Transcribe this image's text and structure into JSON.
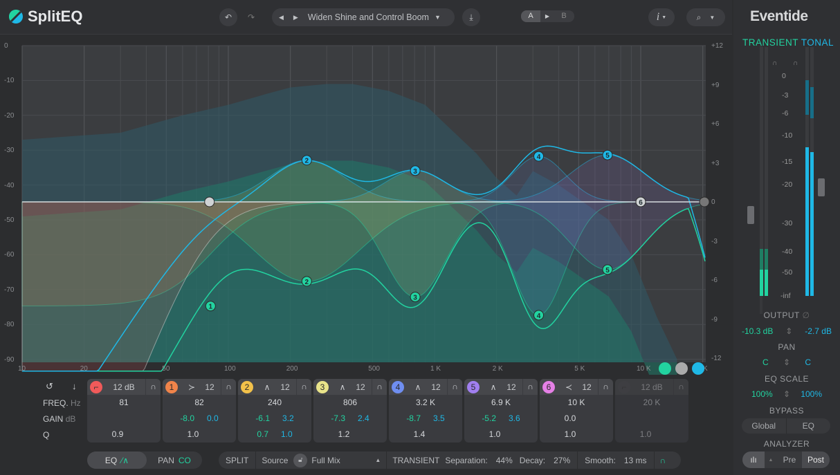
{
  "app": {
    "title": "SplitEQ",
    "preset": "Widen Shine and Control Boom",
    "ab": {
      "a": "A",
      "b": "B"
    },
    "info": "i"
  },
  "colors": {
    "transient": "#22d3a0",
    "tonal": "#1fb8e6",
    "band1": "#f0844a",
    "band2": "#f2c14a",
    "band3": "#e9e48a",
    "band4": "#6f8ef0",
    "band5": "#a17ff0",
    "band6": "#e580e6",
    "lowcut": "#f05a5a"
  },
  "graph": {
    "left_axis": [
      "0",
      "-10",
      "-20",
      "-30",
      "-40",
      "-50",
      "-60",
      "-70",
      "-80",
      "-90"
    ],
    "right_axis": [
      "+12",
      "+9",
      "+6",
      "+3",
      "0",
      "-3",
      "-6",
      "-9",
      "-12"
    ],
    "freq_axis": [
      {
        "f": 10,
        "l": "10"
      },
      {
        "f": 20,
        "l": "20"
      },
      {
        "f": 50,
        "l": "50"
      },
      {
        "f": 100,
        "l": "100"
      },
      {
        "f": 200,
        "l": "200"
      },
      {
        "f": 500,
        "l": "500"
      },
      {
        "f": 1000,
        "l": "1 K"
      },
      {
        "f": 2000,
        "l": "2 K"
      },
      {
        "f": 5000,
        "l": "5 K"
      },
      {
        "f": 10000,
        "l": "10 K"
      },
      {
        "f": 21000,
        "l": "K"
      }
    ]
  },
  "row_labels": {
    "freq": "FREQ.",
    "freq_unit": "Hz",
    "gain": "GAIN",
    "gain_unit": "dB",
    "q": "Q"
  },
  "bands": [
    {
      "id": "lowcut",
      "num": "",
      "type_icon": "lowcut-icon",
      "slope": "12 dB",
      "freq": "81",
      "freq_hz": 81,
      "gain_t": "",
      "gain_s": "",
      "q_t": "0.9",
      "q_s": "",
      "enabled": true
    },
    {
      "id": "1",
      "num": "1",
      "type_icon": "low-shelf-icon",
      "slope": "12",
      "freq": "82",
      "freq_hz": 82,
      "gain_t": "-8.0",
      "gain_s": "0.0",
      "q_t": "1.0",
      "q_s": "",
      "enabled": true
    },
    {
      "id": "2",
      "num": "2",
      "type_icon": "bell-icon",
      "slope": "12",
      "freq": "240",
      "freq_hz": 240,
      "gain_t": "-6.1",
      "gain_s": "3.2",
      "q_t": "0.7",
      "q_s": "1.0",
      "enabled": true
    },
    {
      "id": "3",
      "num": "3",
      "type_icon": "bell-icon",
      "slope": "12",
      "freq": "806",
      "freq_hz": 806,
      "gain_t": "-7.3",
      "gain_s": "2.4",
      "q_t": "1.2",
      "q_s": "",
      "enabled": true
    },
    {
      "id": "4",
      "num": "4",
      "type_icon": "bell-icon",
      "slope": "12",
      "freq": "3.2 K",
      "freq_hz": 3200,
      "gain_t": "-8.7",
      "gain_s": "3.5",
      "q_t": "1.4",
      "q_s": "",
      "enabled": true
    },
    {
      "id": "5",
      "num": "5",
      "type_icon": "bell-icon",
      "slope": "12",
      "freq": "6.9 K",
      "freq_hz": 6900,
      "gain_t": "-5.2",
      "gain_s": "3.6",
      "q_t": "1.0",
      "q_s": "",
      "enabled": true
    },
    {
      "id": "6",
      "num": "6",
      "type_icon": "high-shelf-icon",
      "slope": "12",
      "freq": "10 K",
      "freq_hz": 10000,
      "gain_t": "0.0",
      "gain_s": "",
      "q_t": "1.0",
      "q_s": "",
      "enabled": true
    },
    {
      "id": "highcut",
      "num": "",
      "type_icon": "highcut-icon",
      "slope": "12 dB",
      "freq": "20 K",
      "freq_hz": 20000,
      "gain_t": "",
      "gain_s": "",
      "q_t": "1.0",
      "q_s": "",
      "enabled": false
    }
  ],
  "bottom": {
    "eq": "EQ",
    "pan": "PAN",
    "split": "SPLIT",
    "source": "Source",
    "source_value": "Full Mix",
    "transient": "TRANSIENT",
    "separation_label": "Separation:",
    "separation": "44%",
    "decay_label": "Decay:",
    "decay": "27%",
    "smooth_label": "Smooth:",
    "smooth": "13 ms"
  },
  "right": {
    "brand": "Eventide",
    "transient": "TRANSIENT",
    "tonal": "TONAL",
    "meter_scale": [
      "0",
      "-3",
      "-6",
      "-10",
      "-15",
      "-20",
      "-30",
      "-40",
      "-50",
      "-inf"
    ],
    "output_label": "OUTPUT",
    "output_t": "-10.3 dB",
    "output_s": "-2.7 dB",
    "pan_label": "PAN",
    "pan_t": "C",
    "pan_s": "C",
    "eqscale_label": "EQ SCALE",
    "eqscale_t": "100%",
    "eqscale_s": "100%",
    "bypass_label": "BYPASS",
    "bypass_global": "Global",
    "bypass_eq": "EQ",
    "analyzer_label": "ANALYZER",
    "pre": "Pre",
    "post": "Post",
    "analyzer_selected": "Post"
  }
}
